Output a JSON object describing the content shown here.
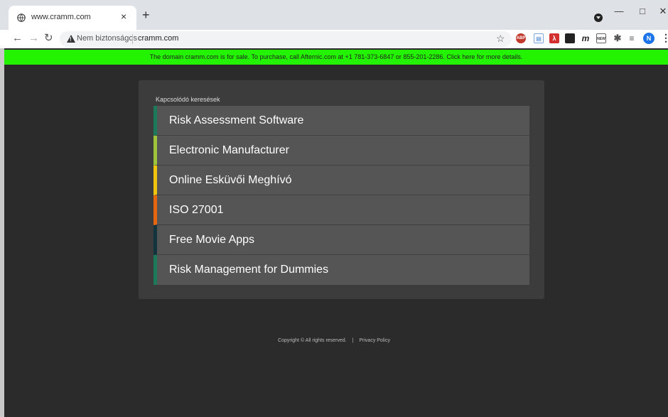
{
  "browser": {
    "tab_title": "www.cramm.com",
    "tab_close": "×",
    "new_tab": "+",
    "security_label": "Nem biztonságos",
    "url": "cramm.com",
    "avatar_letter": "N",
    "extensions": [
      "adblock-icon",
      "document-icon",
      "pdf-icon",
      "dark-square-icon",
      "m-icon",
      "new-badge-icon",
      "puzzle-icon",
      "reading-list-icon"
    ]
  },
  "banner": {
    "text": "The domain cramm.com is for sale. To purchase, call Afternic.com at +1 781-373-6847 or 855-201-2286. Click here for more details.",
    "color": "#23f300"
  },
  "related": {
    "heading": "Kapcsolódó keresések",
    "items": [
      {
        "label": "Risk Assessment Software",
        "accent": "#1c7a5b"
      },
      {
        "label": "Electronic Manufacturer",
        "accent": "#9fc33b"
      },
      {
        "label": "Online Esküvői Meghívó",
        "accent": "#f1c40f"
      },
      {
        "label": "ISO 27001",
        "accent": "#e8650f"
      },
      {
        "label": "Free Movie Apps",
        "accent": "#12343f"
      },
      {
        "label": "Risk Management for Dummies",
        "accent": "#1c7a5b"
      }
    ]
  },
  "footer": {
    "copyright": "Copyright © All rights reserved.",
    "separator": "|",
    "privacy": "Privacy Policy"
  }
}
